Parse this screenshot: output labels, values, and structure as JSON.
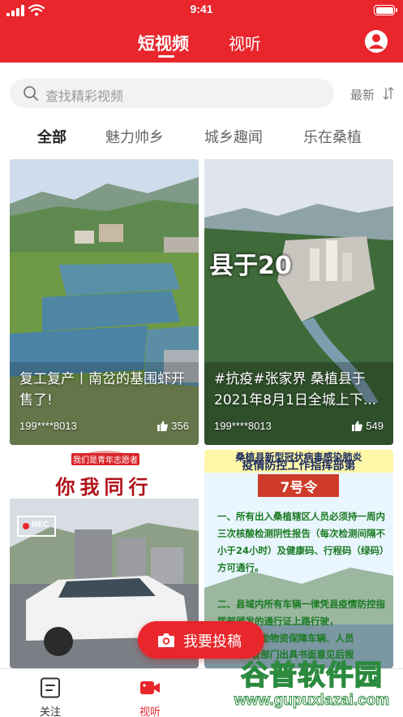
{
  "status_bar": {
    "time": "9:41"
  },
  "header": {
    "tabs": [
      {
        "label": "短视频",
        "active": true
      },
      {
        "label": "视听",
        "active": false
      }
    ]
  },
  "search": {
    "placeholder": "查找精彩视频",
    "sort_label": "最新"
  },
  "categories": [
    {
      "label": "全部",
      "active": true
    },
    {
      "label": "魅力帅乡",
      "active": false
    },
    {
      "label": "城乡趣闻",
      "active": false
    },
    {
      "label": "乐在桑植",
      "active": false
    }
  ],
  "cards": [
    {
      "title": "复工复产丨南岔的基围虾开售了!",
      "user": "199****8013",
      "likes": "356"
    },
    {
      "title": "#抗疫#张家界 桑植县于2021年8月1日全城上下...",
      "user": "199****8013",
      "likes": "549",
      "overlay_text": "县于20"
    },
    {
      "banner": "我们是青年志愿者",
      "slogan": "你我同行",
      "rec_label": "REC"
    },
    {
      "heading_1": "桑植县新型冠状病毒感染肺炎",
      "heading_2": "疫情防控工作指挥部第",
      "order_number": "7号令",
      "paragraph_1": "一、所有出入桑植辖区人员必须持一周内三次核酸检测阴性报告（每次检测间隔不小于24小时）及健康码、行程码（绿码）方可通行。",
      "paragraph_2": "二、县域内所有车辆一律凭县疫情防控指挥部颁发的通行证上路行驶，",
      "paragraph_3": "通勤物资保障车辆、人员",
      "paragraph_4": "管部门出具书面意见后报"
    }
  ],
  "upload": {
    "label": "我要投稿"
  },
  "bottom_nav": [
    {
      "label": "关注",
      "active": false
    },
    {
      "label": "视听",
      "active": true
    },
    {
      "label": "",
      "active": false
    },
    {
      "label": "",
      "active": false
    }
  ],
  "watermark": {
    "title": "谷普软件园",
    "url": "www.gupuxlazai.com"
  },
  "colors": {
    "brand_red": "#e8262c",
    "watermark_green": "#2b8a3e"
  }
}
